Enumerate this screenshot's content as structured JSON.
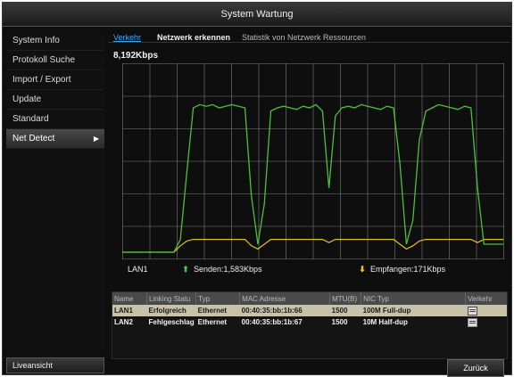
{
  "window": {
    "title": "System Wartung"
  },
  "sidebar": {
    "items": [
      {
        "label": "System Info"
      },
      {
        "label": "Protokoll Suche"
      },
      {
        "label": "Import / Export"
      },
      {
        "label": "Update"
      },
      {
        "label": "Standard"
      },
      {
        "label": "Net Detect",
        "active": true
      }
    ],
    "arrow": "▶",
    "live_button": "Liveansicht"
  },
  "tabs": [
    {
      "label": "Verkehr",
      "active": true
    },
    {
      "label": "Netzwerk erkennen"
    },
    {
      "label": "Statistik von Netzwerk Ressourcen"
    }
  ],
  "graph": {
    "max_label": "8,192Kbps",
    "colors": {
      "send": "#4fbf3a",
      "receive": "#e0c21a",
      "grid": "#7d7d7d"
    },
    "send_series": [
      0,
      0,
      0,
      0,
      0,
      0,
      0,
      0,
      0,
      0.08,
      0.5,
      0.9,
      0.92,
      0.91,
      0.92,
      0.9,
      0.91,
      0.92,
      0.91,
      0.9,
      0.35,
      0.05,
      0.3,
      0.88,
      0.9,
      0.91,
      0.9,
      0.89,
      0.91,
      0.9,
      0.92,
      0.88,
      0.4,
      0.85,
      0.9,
      0.91,
      0.9,
      0.92,
      0.91,
      0.9,
      0.89,
      0.91,
      0.9,
      0.55,
      0.05,
      0.2,
      0.7,
      0.88,
      0.9,
      0.92,
      0.91,
      0.9,
      0.89,
      0.91,
      0.9,
      0.4,
      0.05,
      0.05,
      0.05,
      0.05
    ],
    "receive_series": [
      0,
      0,
      0,
      0,
      0,
      0,
      0,
      0,
      0,
      0.04,
      0.07,
      0.08,
      0.08,
      0.08,
      0.08,
      0.08,
      0.08,
      0.08,
      0.08,
      0.08,
      0.04,
      0.02,
      0.05,
      0.08,
      0.08,
      0.08,
      0.08,
      0.08,
      0.08,
      0.08,
      0.08,
      0.08,
      0.06,
      0.08,
      0.08,
      0.08,
      0.08,
      0.08,
      0.08,
      0.08,
      0.08,
      0.08,
      0.08,
      0.05,
      0.02,
      0.04,
      0.07,
      0.08,
      0.08,
      0.08,
      0.08,
      0.08,
      0.08,
      0.08,
      0.08,
      0.06,
      0.08,
      0.08,
      0.08,
      0.08
    ]
  },
  "legend": {
    "interface": "LAN1",
    "send": "Senden:1,583Kbps",
    "receive": "Empfangen:171Kbps"
  },
  "table": {
    "headers": [
      "Name",
      "Linking Statu",
      "Typ",
      "MAC Adresse",
      "MTU(B)",
      "NIC Typ",
      "Verkehr"
    ],
    "rows": [
      {
        "name": "LAN1",
        "status": "Erfolgreich",
        "type": "Ethernet",
        "mac": "00:40:35:bb:1b:66",
        "mtu": "1500",
        "nic": "100M Full-dup",
        "selected": true
      },
      {
        "name": "LAN2",
        "status": "Fehlgeschlag",
        "type": "Ethernet",
        "mac": "00:40:35:bb:1b:67",
        "mtu": "1500",
        "nic": "10M Half-dup",
        "selected": false
      }
    ]
  },
  "buttons": {
    "back": "Zurück"
  }
}
